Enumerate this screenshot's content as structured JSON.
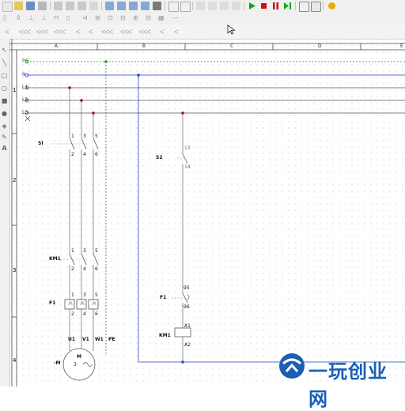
{
  "toolbar": {
    "row1_icons": [
      "new-icon",
      "open-icon",
      "save-icon",
      "print-icon",
      "cut-icon",
      "copy-icon",
      "paste-icon",
      "delete-icon",
      "zoom-in-icon",
      "zoom-out-icon",
      "zoom-fit-icon",
      "zoom-area-icon",
      "undo-icon",
      "redo-icon",
      "arrange-icon",
      "arrange2-icon",
      "arrange3-icon",
      "arrange4-icon",
      "run-icon",
      "stop-icon",
      "pause-icon",
      "step-icon",
      "window-icon",
      "settings-icon",
      "help-icon"
    ],
    "colors": {
      "run": "#1aa51a",
      "stop": "#d01010",
      "pause": "#d01010",
      "help": "#e0b000"
    }
  },
  "sheet": {
    "columns": [
      "A",
      "B",
      "C",
      "D",
      "E"
    ],
    "rows": [
      "1",
      "2",
      "3",
      "4"
    ]
  },
  "power_rails": {
    "labels": [
      "PE",
      "N",
      "L1",
      "L2",
      "L3"
    ],
    "colors": {
      "pe": "#2f8f2f",
      "n": "#2a3fbf",
      "phase": "#8a1c1c"
    }
  },
  "components": {
    "si": {
      "tag": "SI",
      "pins_top": [
        "1",
        "3",
        "5"
      ],
      "pins_bottom": [
        "2",
        "4",
        "6"
      ]
    },
    "km1_contacts": {
      "tag": "KM1",
      "pins_top": [
        "1",
        "3",
        "5"
      ],
      "pins_bottom": [
        "2",
        "4",
        "6"
      ]
    },
    "f1_relay": {
      "tag": "F1",
      "pins_top": [
        "1",
        "3",
        "5"
      ],
      "pins_bottom": [
        "2",
        "4",
        "6"
      ]
    },
    "motor": {
      "terminals": [
        "U1",
        "V1",
        "W1",
        "PE"
      ],
      "letter": "M",
      "phases": "3",
      "prefix": "-M"
    },
    "s2": {
      "tag": "S2",
      "pin_top": "13",
      "pin_bottom": "14"
    },
    "f1_contact": {
      "tag": "F1",
      "pin_top": "95",
      "pin_bottom": "96"
    },
    "km1_coil": {
      "tag": "KM1",
      "pin_top": "A1",
      "pin_bottom": "A2"
    }
  },
  "watermark": {
    "text": "一玩创业网"
  }
}
